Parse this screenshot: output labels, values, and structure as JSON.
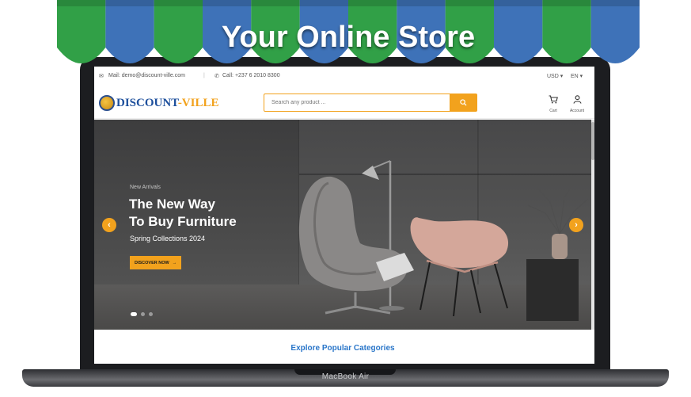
{
  "banner": {
    "title": "Your Online Store"
  },
  "device": {
    "label": "MacBook Air"
  },
  "topbar": {
    "email": "Mail: demo@discount-ville.com",
    "phone": "Call: +237 6 2010 8300",
    "currency": "USD ▾",
    "language": "EN ▾"
  },
  "header": {
    "logo_part1": "DISCOUNT",
    "logo_part2": "-VILLE",
    "search_placeholder": "Search any product ...",
    "cart_label": "Cart",
    "account_label": "Account"
  },
  "hero": {
    "eyebrow": "New Arrivals",
    "heading_line1": "The New Way",
    "heading_line2": "To Buy Furniture",
    "subtitle": "Spring Collections 2024",
    "cta_label": "DISCOVER NOW",
    "cta_arrow": "→",
    "prev_arrow": "‹",
    "next_arrow": "›",
    "slide_count": 3,
    "active_slide": 1
  },
  "sections": {
    "categories_heading": "Explore Popular Categories"
  },
  "colors": {
    "accent": "#f2a21d",
    "brand_blue": "#1d4f9c",
    "awning_green": "#31a047",
    "awning_blue": "#3e72b8",
    "link_blue": "#2a76c9"
  },
  "icons": {
    "search": "search-icon",
    "cart": "cart-icon",
    "account": "user-icon",
    "mail": "mail-icon",
    "phone": "phone-icon"
  }
}
